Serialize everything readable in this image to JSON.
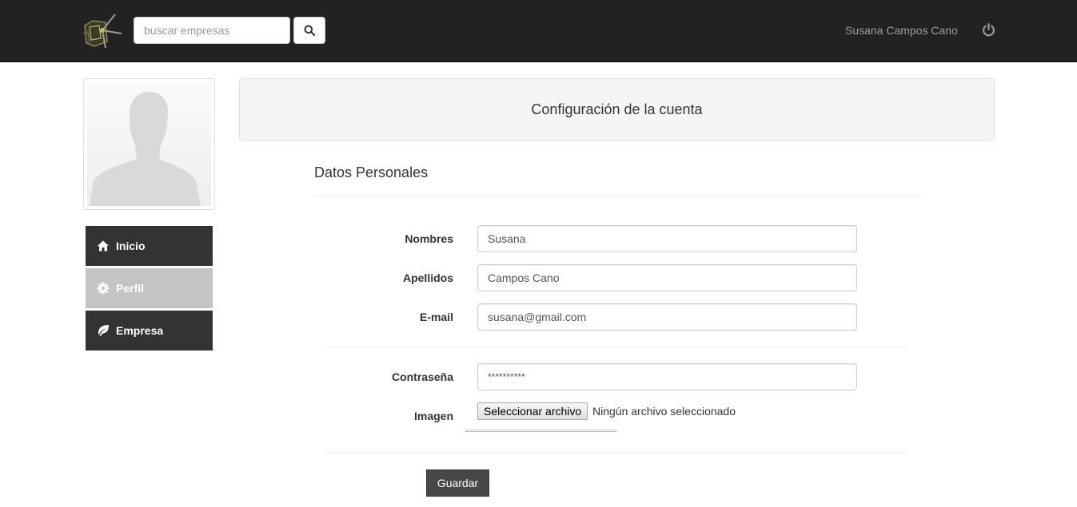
{
  "navbar": {
    "search_placeholder": "buscar empresas",
    "user_name": "Susana Campos Cano"
  },
  "sidebar": {
    "items": [
      {
        "label": "Inicio",
        "icon": "home-icon"
      },
      {
        "label": "Perfil",
        "icon": "gear-icon",
        "active": true
      },
      {
        "label": "Empresa",
        "icon": "leaf-icon"
      }
    ]
  },
  "main": {
    "header_title": "Configuración de la cuenta",
    "section_title": "Datos Personales",
    "fields": {
      "nombres": {
        "label": "Nombres",
        "value": "Susana"
      },
      "apellidos": {
        "label": "Apellidos",
        "value": "Campos Cano"
      },
      "email": {
        "label": "E-mail",
        "value": "susana@gmail.com"
      },
      "password": {
        "label": "Contraseña",
        "value": "**********"
      },
      "imagen": {
        "label": "Imagen",
        "button": "Seleccionar archivo",
        "status": "Ningún archivo seleccionado"
      }
    },
    "save_label": "Guardar"
  },
  "colors": {
    "navbar_bg": "#222222",
    "menu_bg": "#333333",
    "menu_active_bg": "#c4c4c4",
    "save_button_bg": "#474747"
  }
}
